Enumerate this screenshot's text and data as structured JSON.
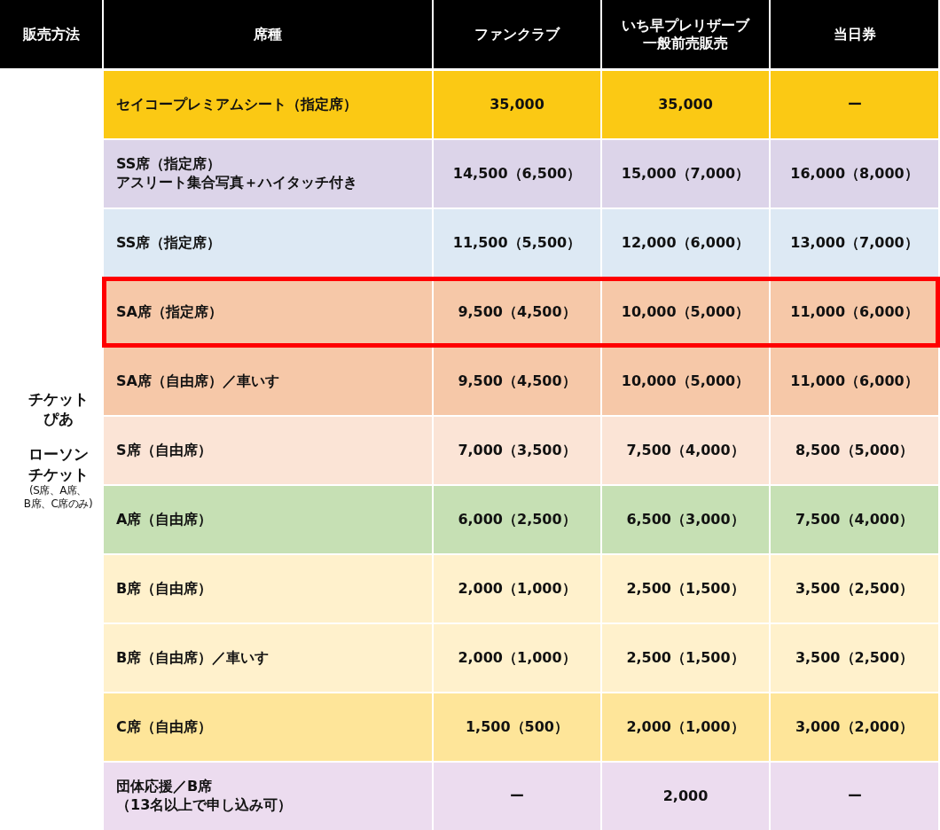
{
  "table": {
    "columns": [
      "販売方法",
      "席種",
      "ファンクラブ",
      [
        "いち早プレリザーブ",
        "一般前売販売"
      ],
      "当日券"
    ],
    "sales_method": [
      [
        "チケット",
        "ぴあ"
      ],
      [
        "ローソン",
        "チケット"
      ],
      [
        "(S席、A席、",
        "B席、C席のみ)"
      ]
    ],
    "rows": [
      {
        "seat": "セイコープレミアムシート（指定席）",
        "prices": [
          "35,000",
          "35,000",
          "ー"
        ],
        "color": "#fbc914",
        "highlighted": false
      },
      {
        "seat": [
          "SS席（指定席）",
          "アスリート集合写真＋ハイタッチ付き"
        ],
        "prices": [
          "14,500（6,500）",
          "15,000（7,000）",
          "16,000（8,000）"
        ],
        "color": "#dcd4e9",
        "highlighted": false
      },
      {
        "seat": "SS席（指定席）",
        "prices": [
          "11,500（5,500）",
          "12,000（6,000）",
          "13,000（7,000）"
        ],
        "color": "#dde9f4",
        "highlighted": false
      },
      {
        "seat": "SA席（指定席）",
        "prices": [
          "9,500（4,500）",
          "10,000（5,000）",
          "11,000（6,000）"
        ],
        "color": "#f6c8a8",
        "highlighted": true
      },
      {
        "seat": "SA席（自由席）／車いす",
        "prices": [
          "9,500（4,500）",
          "10,000（5,000）",
          "11,000（6,000）"
        ],
        "color": "#f6c8a8",
        "highlighted": false
      },
      {
        "seat": "S席（自由席）",
        "prices": [
          "7,000（3,500）",
          "7,500（4,000）",
          "8,500（5,000）"
        ],
        "color": "#fbe4d6",
        "highlighted": false
      },
      {
        "seat": "A席（自由席）",
        "prices": [
          "6,000（2,500）",
          "6,500（3,000）",
          "7,500（4,000）"
        ],
        "color": "#c6e0b4",
        "highlighted": false
      },
      {
        "seat": "B席（自由席）",
        "prices": [
          "2,000（1,000）",
          "2,500（1,500）",
          "3,500（2,500）"
        ],
        "color": "#fff1cc",
        "highlighted": false
      },
      {
        "seat": "B席（自由席）／車いす",
        "prices": [
          "2,000（1,000）",
          "2,500（1,500）",
          "3,500（2,500）"
        ],
        "color": "#fff1cc",
        "highlighted": false
      },
      {
        "seat": "C席（自由席）",
        "prices": [
          "1,500（500）",
          "2,000（1,000）",
          "3,000（2,000）"
        ],
        "color": "#fee599",
        "highlighted": false
      },
      {
        "seat": [
          "団体応援／B席",
          "（13名以上で申し込み可）"
        ],
        "prices": [
          "ー",
          "2,000",
          "ー"
        ],
        "color": "#ecdcef",
        "highlighted": false
      }
    ]
  }
}
